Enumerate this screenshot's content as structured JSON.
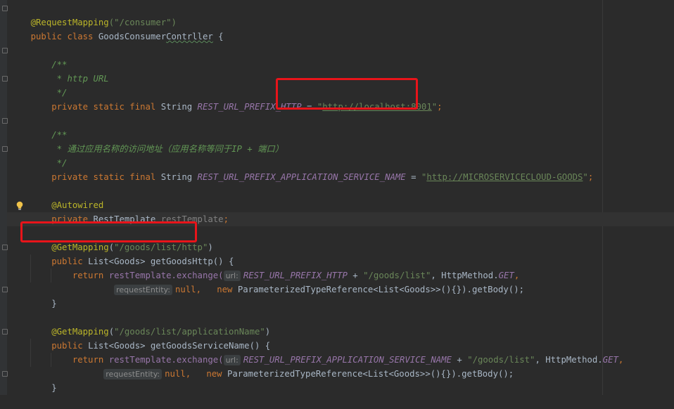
{
  "editor": {
    "lines": [
      [
        "@RequestMapping",
        "(\"/consumer\")"
      ],
      [
        "public class ",
        "GoodsConsumer",
        "Contrller",
        " {"
      ],
      [],
      [
        "    /**"
      ],
      [
        "     * http URL"
      ],
      [
        "     */"
      ],
      [
        "    private static final ",
        "String ",
        "REST_URL_PREFIX_HTTP",
        " = ",
        "\"",
        "http://localhost:8001",
        "\"",
        ";"
      ],
      [],
      [
        "    /**"
      ],
      [
        "     * 通过应用名称的访问地址（应用名称等同于IP + 端口）"
      ],
      [
        "     */"
      ],
      [
        "    private static final ",
        "String ",
        "REST_URL_PREFIX_APPLICATION_SERVICE_NAME",
        " = ",
        "\"",
        "http://MICROSERVICECLOUD-GOODS",
        "\"",
        ";"
      ],
      [],
      [
        "    @Autowired"
      ],
      [
        "    private ",
        "RestTemplate ",
        "restTemplate",
        ";"
      ],
      [],
      [
        "    @GetMapping",
        "(",
        "\"/goods/list/http\"",
        ")"
      ],
      [
        "    public ",
        "List<Goods> getGoodsHttp() {"
      ],
      [
        "        return ",
        "restTemplate.exchange(",
        "url:",
        "REST_URL_PREFIX_HTTP",
        " + ",
        "\"/goods/list\"",
        ", HttpMethod.",
        "GET",
        ","
      ],
      [
        "                ",
        "requestEntity:",
        "null",
        ",   ",
        "new ",
        "ParameterizedTypeReference<List<Goods>>(){}).getBody();"
      ],
      [
        "    }"
      ],
      [],
      [
        "    @GetMapping",
        "(",
        "\"/goods/list/applicationName\"",
        ")"
      ],
      [
        "    public ",
        "List<Goods> getGoodsServiceName() {"
      ],
      [
        "        return ",
        "restTemplate.exchange(",
        "url:",
        "REST_URL_PREFIX_APPLICATION_SERVICE_NAME",
        " + ",
        "\"/goods/list\"",
        ", HttpMethod.",
        "GET",
        ","
      ],
      [
        "              ",
        "requestEntity:",
        "null",
        ",   ",
        "new ",
        "ParameterizedTypeReference<List<Goods>>(){}).getBody();"
      ],
      [
        "    }"
      ]
    ]
  },
  "colors": {
    "background": "#2b2b2b",
    "highlight_box": "#e8141a",
    "keyword": "#cc7832",
    "annotation": "#bbb529",
    "string": "#6a8759",
    "comment": "#629755",
    "constant": "#9876aa"
  },
  "icons": {
    "intention_bulb": "lightbulb-icon"
  }
}
